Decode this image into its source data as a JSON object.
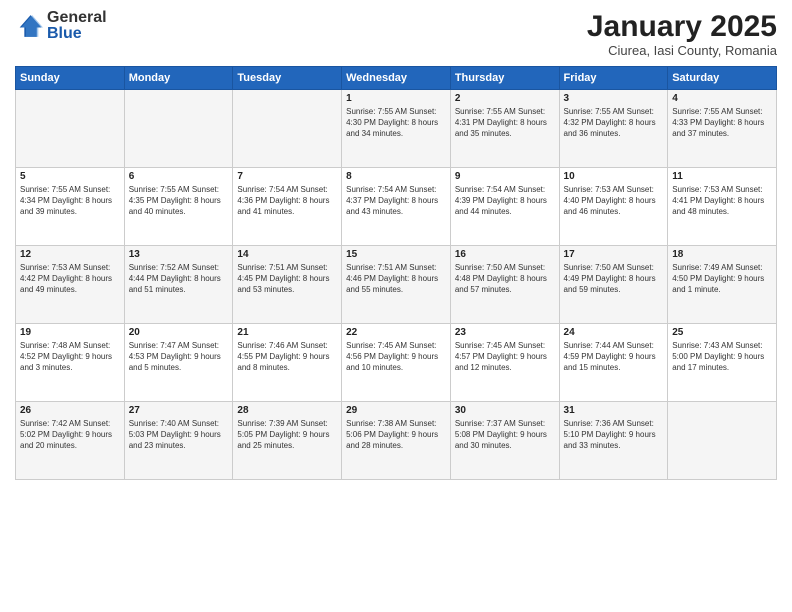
{
  "logo": {
    "general": "General",
    "blue": "Blue"
  },
  "title": "January 2025",
  "subtitle": "Ciurea, Iasi County, Romania",
  "days_of_week": [
    "Sunday",
    "Monday",
    "Tuesday",
    "Wednesday",
    "Thursday",
    "Friday",
    "Saturday"
  ],
  "weeks": [
    [
      {
        "day": "",
        "info": ""
      },
      {
        "day": "",
        "info": ""
      },
      {
        "day": "",
        "info": ""
      },
      {
        "day": "1",
        "info": "Sunrise: 7:55 AM\nSunset: 4:30 PM\nDaylight: 8 hours\nand 34 minutes."
      },
      {
        "day": "2",
        "info": "Sunrise: 7:55 AM\nSunset: 4:31 PM\nDaylight: 8 hours\nand 35 minutes."
      },
      {
        "day": "3",
        "info": "Sunrise: 7:55 AM\nSunset: 4:32 PM\nDaylight: 8 hours\nand 36 minutes."
      },
      {
        "day": "4",
        "info": "Sunrise: 7:55 AM\nSunset: 4:33 PM\nDaylight: 8 hours\nand 37 minutes."
      }
    ],
    [
      {
        "day": "5",
        "info": "Sunrise: 7:55 AM\nSunset: 4:34 PM\nDaylight: 8 hours\nand 39 minutes."
      },
      {
        "day": "6",
        "info": "Sunrise: 7:55 AM\nSunset: 4:35 PM\nDaylight: 8 hours\nand 40 minutes."
      },
      {
        "day": "7",
        "info": "Sunrise: 7:54 AM\nSunset: 4:36 PM\nDaylight: 8 hours\nand 41 minutes."
      },
      {
        "day": "8",
        "info": "Sunrise: 7:54 AM\nSunset: 4:37 PM\nDaylight: 8 hours\nand 43 minutes."
      },
      {
        "day": "9",
        "info": "Sunrise: 7:54 AM\nSunset: 4:39 PM\nDaylight: 8 hours\nand 44 minutes."
      },
      {
        "day": "10",
        "info": "Sunrise: 7:53 AM\nSunset: 4:40 PM\nDaylight: 8 hours\nand 46 minutes."
      },
      {
        "day": "11",
        "info": "Sunrise: 7:53 AM\nSunset: 4:41 PM\nDaylight: 8 hours\nand 48 minutes."
      }
    ],
    [
      {
        "day": "12",
        "info": "Sunrise: 7:53 AM\nSunset: 4:42 PM\nDaylight: 8 hours\nand 49 minutes."
      },
      {
        "day": "13",
        "info": "Sunrise: 7:52 AM\nSunset: 4:44 PM\nDaylight: 8 hours\nand 51 minutes."
      },
      {
        "day": "14",
        "info": "Sunrise: 7:51 AM\nSunset: 4:45 PM\nDaylight: 8 hours\nand 53 minutes."
      },
      {
        "day": "15",
        "info": "Sunrise: 7:51 AM\nSunset: 4:46 PM\nDaylight: 8 hours\nand 55 minutes."
      },
      {
        "day": "16",
        "info": "Sunrise: 7:50 AM\nSunset: 4:48 PM\nDaylight: 8 hours\nand 57 minutes."
      },
      {
        "day": "17",
        "info": "Sunrise: 7:50 AM\nSunset: 4:49 PM\nDaylight: 8 hours\nand 59 minutes."
      },
      {
        "day": "18",
        "info": "Sunrise: 7:49 AM\nSunset: 4:50 PM\nDaylight: 9 hours\nand 1 minute."
      }
    ],
    [
      {
        "day": "19",
        "info": "Sunrise: 7:48 AM\nSunset: 4:52 PM\nDaylight: 9 hours\nand 3 minutes."
      },
      {
        "day": "20",
        "info": "Sunrise: 7:47 AM\nSunset: 4:53 PM\nDaylight: 9 hours\nand 5 minutes."
      },
      {
        "day": "21",
        "info": "Sunrise: 7:46 AM\nSunset: 4:55 PM\nDaylight: 9 hours\nand 8 minutes."
      },
      {
        "day": "22",
        "info": "Sunrise: 7:45 AM\nSunset: 4:56 PM\nDaylight: 9 hours\nand 10 minutes."
      },
      {
        "day": "23",
        "info": "Sunrise: 7:45 AM\nSunset: 4:57 PM\nDaylight: 9 hours\nand 12 minutes."
      },
      {
        "day": "24",
        "info": "Sunrise: 7:44 AM\nSunset: 4:59 PM\nDaylight: 9 hours\nand 15 minutes."
      },
      {
        "day": "25",
        "info": "Sunrise: 7:43 AM\nSunset: 5:00 PM\nDaylight: 9 hours\nand 17 minutes."
      }
    ],
    [
      {
        "day": "26",
        "info": "Sunrise: 7:42 AM\nSunset: 5:02 PM\nDaylight: 9 hours\nand 20 minutes."
      },
      {
        "day": "27",
        "info": "Sunrise: 7:40 AM\nSunset: 5:03 PM\nDaylight: 9 hours\nand 23 minutes."
      },
      {
        "day": "28",
        "info": "Sunrise: 7:39 AM\nSunset: 5:05 PM\nDaylight: 9 hours\nand 25 minutes."
      },
      {
        "day": "29",
        "info": "Sunrise: 7:38 AM\nSunset: 5:06 PM\nDaylight: 9 hours\nand 28 minutes."
      },
      {
        "day": "30",
        "info": "Sunrise: 7:37 AM\nSunset: 5:08 PM\nDaylight: 9 hours\nand 30 minutes."
      },
      {
        "day": "31",
        "info": "Sunrise: 7:36 AM\nSunset: 5:10 PM\nDaylight: 9 hours\nand 33 minutes."
      },
      {
        "day": "",
        "info": ""
      }
    ]
  ]
}
